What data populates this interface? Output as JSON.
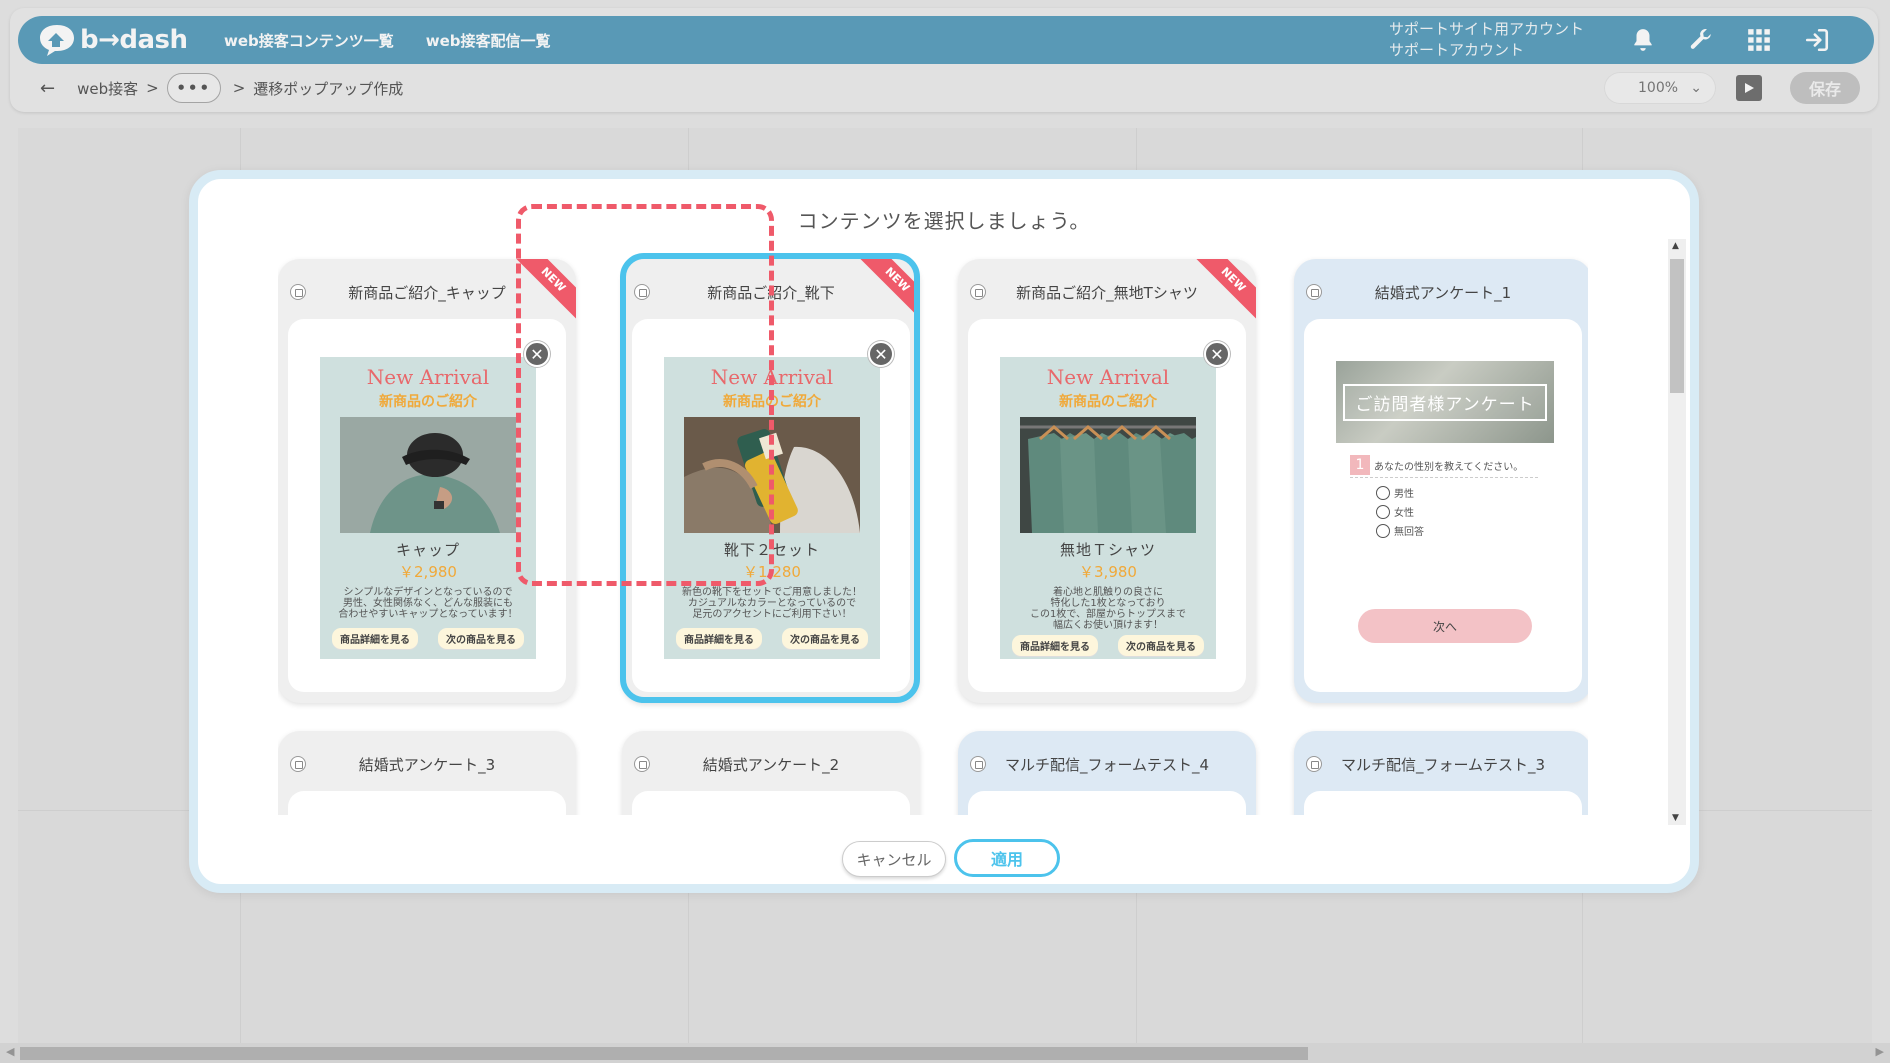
{
  "header": {
    "logo_text": "b→dash",
    "nav": [
      "web接客コンテンツ一覧",
      "web接客配信一覧"
    ],
    "account_line1": "サポートサイト用アカウント",
    "account_line2": "サポートアカウント",
    "icons": [
      "bell-icon",
      "wrench-icon",
      "grid-icon",
      "logout-icon"
    ]
  },
  "subbar": {
    "crumb_root": "web接客",
    "crumb_sep": ">",
    "ellipsis": "•••",
    "crumb_current": "遷移ポップアップ作成",
    "zoom": "100%",
    "save": "保存"
  },
  "modal": {
    "title": "コンテンツを選択しましょう。",
    "cancel": "キャンセル",
    "apply": "適用",
    "cards": [
      {
        "title": "新商品ご紹介_キャップ",
        "ribbon": "NEW",
        "promo": {
          "en": "New Arrival",
          "jp": "新商品のご紹介",
          "name": "キャップ",
          "price": "￥2,980",
          "desc": [
            "シンプルなデザインとなっているので",
            "男性、女性関係なく、どんな服装にも",
            "合わせやすいキャップとなっています！"
          ],
          "btn1": "商品詳細を見る",
          "btn2": "次の商品を見る"
        }
      },
      {
        "title": "新商品ご紹介_靴下",
        "ribbon": "NEW",
        "selected": true,
        "promo": {
          "en": "New Arrival",
          "jp": "新商品のご紹介",
          "name": "靴下２セット",
          "price": "￥1,280",
          "desc": [
            "新色の靴下をセットでご用意しました！",
            "カジュアルなカラーとなっているので",
            "足元のアクセントにご利用下さい！"
          ],
          "btn1": "商品詳細を見る",
          "btn2": "次の商品を見る"
        }
      },
      {
        "title": "新商品ご紹介_無地Tシャツ",
        "ribbon": "NEW",
        "promo": {
          "en": "New Arrival",
          "jp": "新商品のご紹介",
          "name": "無地Ｔシャツ",
          "price": "￥3,980",
          "desc": [
            "着心地と肌触りの良さに",
            "特化した1枚となっており",
            "この1枚で、部屋からトップスまで",
            "幅広くお使い頂けます！"
          ],
          "btn1": "商品詳細を見る",
          "btn2": "次の商品を見る"
        }
      },
      {
        "title": "結婚式アンケート_1",
        "survey": {
          "banner": "ご訪問者様アンケート",
          "q_num": "1",
          "question": "あなたの性別を教えてください。",
          "options": [
            "男性",
            "女性",
            "無回答"
          ],
          "next": "次へ"
        }
      }
    ],
    "cards_row2": [
      "結婚式アンケート_3",
      "結婚式アンケート_2",
      "マルチ配信_フォームテスト_4",
      "マルチ配信_フォームテスト_3"
    ]
  }
}
